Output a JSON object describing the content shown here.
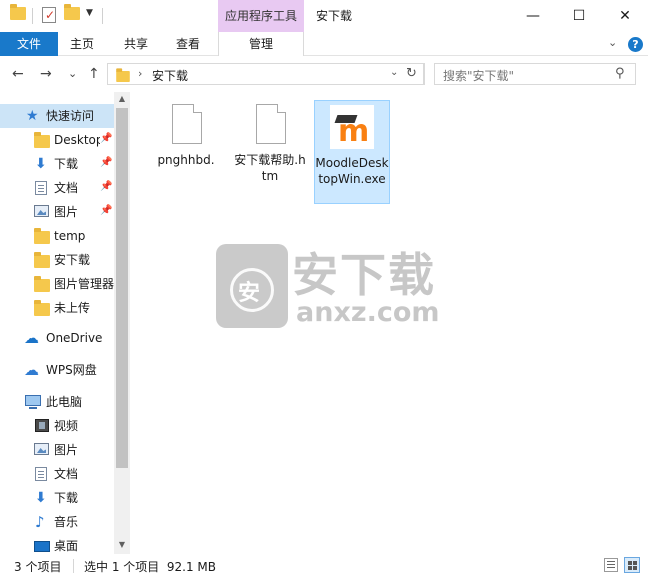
{
  "window": {
    "title": "安下载",
    "context_tab_group": "应用程序工具",
    "minimize_glyph": "—",
    "maximize_glyph": "☐",
    "close_glyph": "✕",
    "qa_dropdown_glyph": "▼"
  },
  "ribbon": {
    "tabs": [
      {
        "label": "文件"
      },
      {
        "label": "主页"
      },
      {
        "label": "共享"
      },
      {
        "label": "查看"
      },
      {
        "label": "管理"
      }
    ],
    "expand_glyph": "⌄",
    "help_glyph": "?"
  },
  "nav": {
    "back_glyph": "←",
    "forward_glyph": "→",
    "recent_glyph": "⌄",
    "up_glyph": "↑",
    "address_chevron": "›",
    "address_path": "安下载",
    "address_dropdown_glyph": "⌄",
    "refresh_glyph": "↻",
    "search_placeholder": "搜索\"安下载\"",
    "search_glyph": "⚲"
  },
  "sidebar": {
    "items": [
      {
        "label": "快速访问",
        "icon": "star-icon"
      },
      {
        "label": "Desktop",
        "icon": "folder-icon",
        "pinned": true
      },
      {
        "label": "下载",
        "icon": "download-icon",
        "pinned": true
      },
      {
        "label": "文档",
        "icon": "document-icon",
        "pinned": true
      },
      {
        "label": "图片",
        "icon": "picture-icon",
        "pinned": true
      },
      {
        "label": "temp",
        "icon": "folder-icon"
      },
      {
        "label": "安下载",
        "icon": "folder-icon"
      },
      {
        "label": "图片管理器",
        "icon": "folder-icon"
      },
      {
        "label": "未上传",
        "icon": "folder-icon"
      },
      {
        "label": "OneDrive",
        "icon": "onedrive-icon"
      },
      {
        "label": "WPS网盘",
        "icon": "wps-cloud-icon"
      },
      {
        "label": "此电脑",
        "icon": "computer-icon"
      },
      {
        "label": "视频",
        "icon": "video-icon"
      },
      {
        "label": "图片",
        "icon": "picture-icon"
      },
      {
        "label": "文档",
        "icon": "document-icon"
      },
      {
        "label": "下载",
        "icon": "download-icon"
      },
      {
        "label": "音乐",
        "icon": "music-icon"
      },
      {
        "label": "桌面",
        "icon": "desktop-icon"
      }
    ],
    "pin_glyph": "📌",
    "scroll_up_glyph": "▲",
    "scroll_down_glyph": "▼"
  },
  "files": [
    {
      "name": "pnghhbd.",
      "icon": "blank-file-icon"
    },
    {
      "name": "安下载帮助.htm",
      "icon": "blank-file-icon"
    },
    {
      "name": "MoodleDesktopWin.exe",
      "icon": "moodle-app-icon",
      "selected": true
    }
  ],
  "watermark": {
    "badge_char": "安",
    "text": "安下载",
    "domain": "anxz.com"
  },
  "status": {
    "item_count": "3 个项目",
    "selection": "选中 1 个项目  92.1 MB"
  },
  "colors": {
    "accent": "#1979ca",
    "selection": "#cce8ff",
    "context_tab": "#e8c9f2",
    "moodle_orange": "#f98012"
  }
}
